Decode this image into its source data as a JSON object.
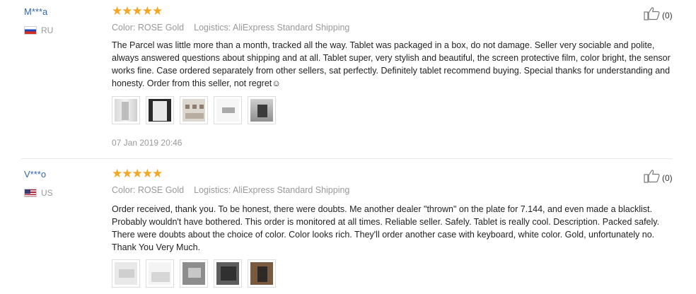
{
  "reviews": [
    {
      "user": "M***a",
      "country": "RU",
      "stars": "★★★★★",
      "color_label": "Color: ROSE Gold",
      "logistics_label": "Logistics: AliExpress Standard Shipping",
      "text": "The Parcel was little more than a month, tracked all the way. Tablet was packaged in a box, do not damage. Seller very sociable and polite, always answered questions about shipping and at all. Tablet super, very stylish and beautiful, the screen protective film, color bright, the sensor works fine. Case ordered separately from other sellers, sat perfectly. Definitely tablet recommend buying. Special thanks for understanding and honesty. Order from this seller, not regret☺",
      "date": "07 Jan 2019 20:46",
      "helpful_count": "(0)",
      "photo_count": 5
    },
    {
      "user": "V***o",
      "country": "US",
      "stars": "★★★★★",
      "color_label": "Color: ROSE Gold",
      "logistics_label": "Logistics: AliExpress Standard Shipping",
      "text": "Order received, thank you. To be honest, there were doubts. Me another dealer \"thrown\" on the plate for 7.144, and even made a blacklist. Probably wouldn't have bothered. This order is monitored at all times. Reliable seller. Safely. Tablet is really cool. Description. Packed safely. There were doubts about the choice of color. Color looks rich. They'll order another case with keyboard, white color. Gold, unfortunately no. Thank You Very Much.",
      "helpful_count": "(0)",
      "photo_count": 5
    }
  ],
  "colors": {
    "star": "#f5a623",
    "username": "#3366aa",
    "muted": "#999999"
  }
}
